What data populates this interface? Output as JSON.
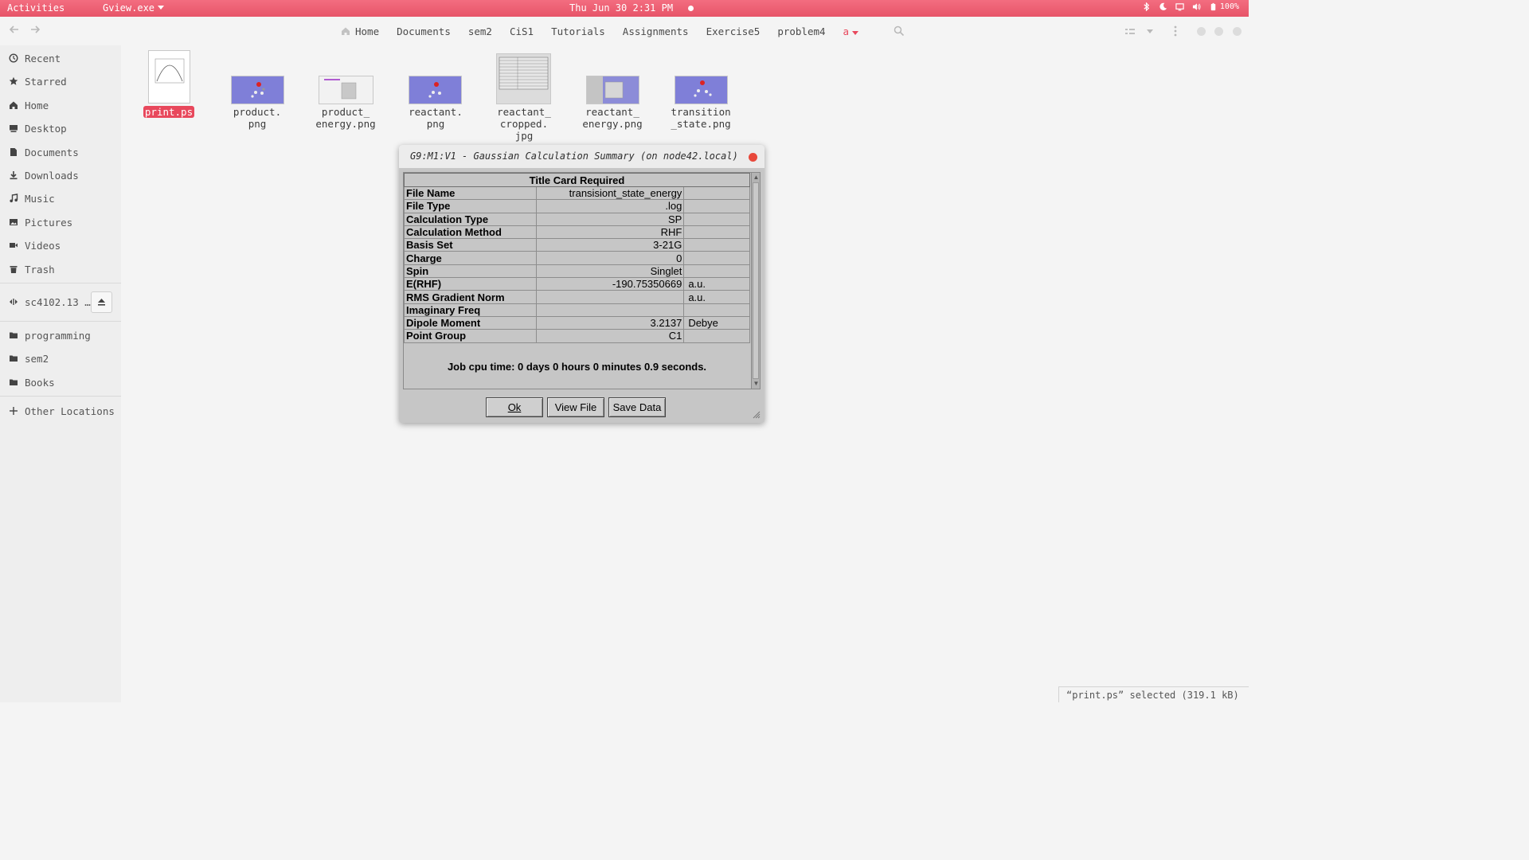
{
  "topbar": {
    "activities": "Activities",
    "app_name": "Gview.exe",
    "clock": "Thu Jun 30  2:31 PM",
    "battery": "100%"
  },
  "headerbar": {
    "path": [
      "Home",
      "Documents",
      "sem2",
      "CiS1",
      "Tutorials",
      "Assignments",
      "Exercise5",
      "problem4",
      "a"
    ]
  },
  "sidebar": {
    "places": [
      "Recent",
      "Starred",
      "Home",
      "Desktop",
      "Documents",
      "Downloads",
      "Music",
      "Pictures",
      "Videos",
      "Trash"
    ],
    "device": "sc4102.13 …",
    "bookmarks": [
      "programming",
      "sem2",
      "Books"
    ],
    "other": "Other Locations"
  },
  "files": [
    {
      "label": "print.ps",
      "selected": true
    },
    {
      "label": "product.\npng"
    },
    {
      "label": "product_\nenergy.png"
    },
    {
      "label": "reactant.\npng"
    },
    {
      "label": "reactant_\ncropped.\njpg"
    },
    {
      "label": "reactant_\nenergy.png"
    },
    {
      "label": "transition\n_state.png"
    }
  ],
  "dialog": {
    "title": "G9:M1:V1 - Gaussian Calculation Summary (on node42.local)",
    "table_title": "Title Card Required",
    "rows": [
      {
        "key": "File Name",
        "value": "transisiont_state_energy",
        "unit": ""
      },
      {
        "key": "File Type",
        "value": ".log",
        "unit": ""
      },
      {
        "key": "Calculation Type",
        "value": "SP",
        "unit": ""
      },
      {
        "key": "Calculation Method",
        "value": "RHF",
        "unit": ""
      },
      {
        "key": "Basis Set",
        "value": "3-21G",
        "unit": ""
      },
      {
        "key": "Charge",
        "value": "0",
        "unit": ""
      },
      {
        "key": "Spin",
        "value": "Singlet",
        "unit": ""
      },
      {
        "key": "E(RHF)",
        "value": "-190.75350669",
        "unit": "a.u."
      },
      {
        "key": "RMS Gradient Norm",
        "value": "",
        "unit": "a.u."
      },
      {
        "key": "Imaginary Freq",
        "value": "",
        "unit": ""
      },
      {
        "key": "Dipole Moment",
        "value": "3.2137",
        "unit": "Debye"
      },
      {
        "key": "Point Group",
        "value": "C1",
        "unit": ""
      }
    ],
    "cpu_time": "Job cpu time:  0 days  0 hours  0 minutes  0.9 seconds.",
    "buttons": {
      "ok": "Ok",
      "view_file": "View File",
      "save_data": "Save Data"
    }
  },
  "status": "“print.ps” selected (319.1 kB)",
  "colors": {
    "accent": "#e8485c",
    "topbar": "#f0637a",
    "dialog_bg": "#c6c6c6"
  }
}
